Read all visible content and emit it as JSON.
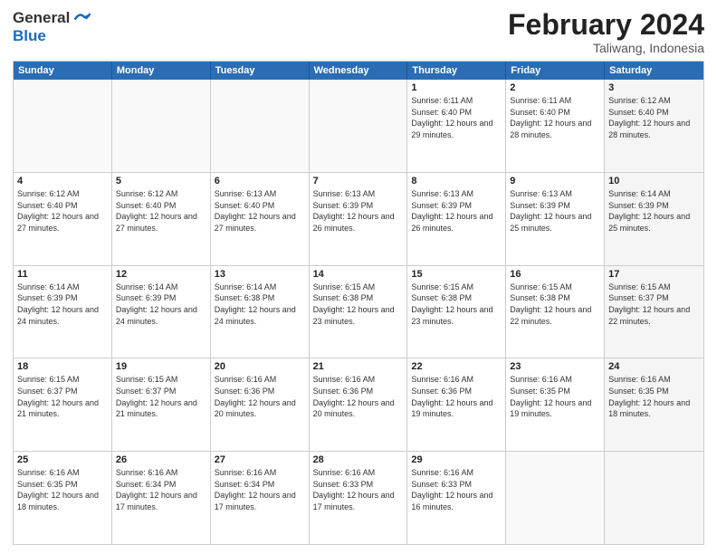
{
  "logo": {
    "general": "General",
    "blue": "Blue"
  },
  "title": {
    "month": "February 2024",
    "location": "Taliwang, Indonesia"
  },
  "header": {
    "days": [
      "Sunday",
      "Monday",
      "Tuesday",
      "Wednesday",
      "Thursday",
      "Friday",
      "Saturday"
    ]
  },
  "rows": [
    [
      {
        "day": "",
        "info": "",
        "empty": true
      },
      {
        "day": "",
        "info": "",
        "empty": true
      },
      {
        "day": "",
        "info": "",
        "empty": true
      },
      {
        "day": "",
        "info": "",
        "empty": true
      },
      {
        "day": "1",
        "info": "Sunrise: 6:11 AM\nSunset: 6:40 PM\nDaylight: 12 hours and 29 minutes.",
        "empty": false
      },
      {
        "day": "2",
        "info": "Sunrise: 6:11 AM\nSunset: 6:40 PM\nDaylight: 12 hours and 28 minutes.",
        "empty": false
      },
      {
        "day": "3",
        "info": "Sunrise: 6:12 AM\nSunset: 6:40 PM\nDaylight: 12 hours and 28 minutes.",
        "empty": false,
        "shaded": true
      }
    ],
    [
      {
        "day": "4",
        "info": "Sunrise: 6:12 AM\nSunset: 6:40 PM\nDaylight: 12 hours and 27 minutes.",
        "empty": false
      },
      {
        "day": "5",
        "info": "Sunrise: 6:12 AM\nSunset: 6:40 PM\nDaylight: 12 hours and 27 minutes.",
        "empty": false
      },
      {
        "day": "6",
        "info": "Sunrise: 6:13 AM\nSunset: 6:40 PM\nDaylight: 12 hours and 27 minutes.",
        "empty": false
      },
      {
        "day": "7",
        "info": "Sunrise: 6:13 AM\nSunset: 6:39 PM\nDaylight: 12 hours and 26 minutes.",
        "empty": false
      },
      {
        "day": "8",
        "info": "Sunrise: 6:13 AM\nSunset: 6:39 PM\nDaylight: 12 hours and 26 minutes.",
        "empty": false
      },
      {
        "day": "9",
        "info": "Sunrise: 6:13 AM\nSunset: 6:39 PM\nDaylight: 12 hours and 25 minutes.",
        "empty": false
      },
      {
        "day": "10",
        "info": "Sunrise: 6:14 AM\nSunset: 6:39 PM\nDaylight: 12 hours and 25 minutes.",
        "empty": false,
        "shaded": true
      }
    ],
    [
      {
        "day": "11",
        "info": "Sunrise: 6:14 AM\nSunset: 6:39 PM\nDaylight: 12 hours and 24 minutes.",
        "empty": false
      },
      {
        "day": "12",
        "info": "Sunrise: 6:14 AM\nSunset: 6:39 PM\nDaylight: 12 hours and 24 minutes.",
        "empty": false
      },
      {
        "day": "13",
        "info": "Sunrise: 6:14 AM\nSunset: 6:38 PM\nDaylight: 12 hours and 24 minutes.",
        "empty": false
      },
      {
        "day": "14",
        "info": "Sunrise: 6:15 AM\nSunset: 6:38 PM\nDaylight: 12 hours and 23 minutes.",
        "empty": false
      },
      {
        "day": "15",
        "info": "Sunrise: 6:15 AM\nSunset: 6:38 PM\nDaylight: 12 hours and 23 minutes.",
        "empty": false
      },
      {
        "day": "16",
        "info": "Sunrise: 6:15 AM\nSunset: 6:38 PM\nDaylight: 12 hours and 22 minutes.",
        "empty": false
      },
      {
        "day": "17",
        "info": "Sunrise: 6:15 AM\nSunset: 6:37 PM\nDaylight: 12 hours and 22 minutes.",
        "empty": false,
        "shaded": true
      }
    ],
    [
      {
        "day": "18",
        "info": "Sunrise: 6:15 AM\nSunset: 6:37 PM\nDaylight: 12 hours and 21 minutes.",
        "empty": false
      },
      {
        "day": "19",
        "info": "Sunrise: 6:15 AM\nSunset: 6:37 PM\nDaylight: 12 hours and 21 minutes.",
        "empty": false
      },
      {
        "day": "20",
        "info": "Sunrise: 6:16 AM\nSunset: 6:36 PM\nDaylight: 12 hours and 20 minutes.",
        "empty": false
      },
      {
        "day": "21",
        "info": "Sunrise: 6:16 AM\nSunset: 6:36 PM\nDaylight: 12 hours and 20 minutes.",
        "empty": false
      },
      {
        "day": "22",
        "info": "Sunrise: 6:16 AM\nSunset: 6:36 PM\nDaylight: 12 hours and 19 minutes.",
        "empty": false
      },
      {
        "day": "23",
        "info": "Sunrise: 6:16 AM\nSunset: 6:35 PM\nDaylight: 12 hours and 19 minutes.",
        "empty": false
      },
      {
        "day": "24",
        "info": "Sunrise: 6:16 AM\nSunset: 6:35 PM\nDaylight: 12 hours and 18 minutes.",
        "empty": false,
        "shaded": true
      }
    ],
    [
      {
        "day": "25",
        "info": "Sunrise: 6:16 AM\nSunset: 6:35 PM\nDaylight: 12 hours and 18 minutes.",
        "empty": false
      },
      {
        "day": "26",
        "info": "Sunrise: 6:16 AM\nSunset: 6:34 PM\nDaylight: 12 hours and 17 minutes.",
        "empty": false
      },
      {
        "day": "27",
        "info": "Sunrise: 6:16 AM\nSunset: 6:34 PM\nDaylight: 12 hours and 17 minutes.",
        "empty": false
      },
      {
        "day": "28",
        "info": "Sunrise: 6:16 AM\nSunset: 6:33 PM\nDaylight: 12 hours and 17 minutes.",
        "empty": false
      },
      {
        "day": "29",
        "info": "Sunrise: 6:16 AM\nSunset: 6:33 PM\nDaylight: 12 hours and 16 minutes.",
        "empty": false
      },
      {
        "day": "",
        "info": "",
        "empty": true
      },
      {
        "day": "",
        "info": "",
        "empty": true,
        "shaded": true
      }
    ]
  ]
}
